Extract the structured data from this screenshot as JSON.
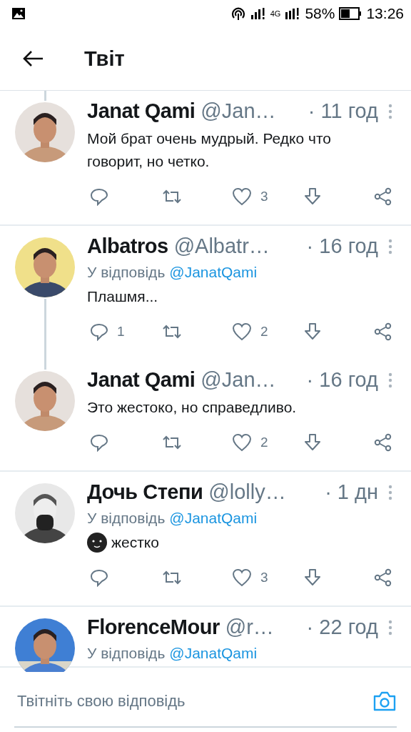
{
  "status_bar": {
    "battery_text": "58%",
    "network": "4G",
    "time": "13:26"
  },
  "header": {
    "title": "Твіт"
  },
  "tweets": [
    {
      "name": "Janat Qami",
      "handle": "@Jan…",
      "time": "· 11 год",
      "text": "Мой брат очень мудрый. Редко что говорит, но четко.",
      "emoji": false,
      "likes": "3",
      "thread_above": true,
      "thread_below": false
    },
    {
      "name": "Albatros",
      "handle": "@Albatr…",
      "time": "· 16 год",
      "reply_prefix": "У відповідь",
      "reply_to": "@JanatQami",
      "text": "Плашмя...",
      "emoji": false,
      "replies": "1",
      "likes": "2",
      "thread_above": false,
      "thread_below": true
    },
    {
      "name": "Janat Qami",
      "handle": "@Jan…",
      "time": "· 16 год",
      "text": "Это жестоко, но справедливо.",
      "emoji": false,
      "likes": "2",
      "thread_above": true,
      "thread_below": false
    },
    {
      "name": "Дочь Степи",
      "handle": "@lolly…",
      "time": "· 1 дн",
      "reply_prefix": "У відповідь",
      "reply_to": "@JanatQami",
      "text": "жестко",
      "emoji": true,
      "likes": "3",
      "thread_above": false,
      "thread_below": false
    },
    {
      "name": "FlorenceMour",
      "handle": "@r…",
      "time": "· 22 год",
      "reply_prefix": "У відповідь",
      "reply_to": "@JanatQami",
      "thread_above": false,
      "thread_below": false
    }
  ],
  "reply_bar": {
    "placeholder": "Твітніть свою відповідь"
  }
}
